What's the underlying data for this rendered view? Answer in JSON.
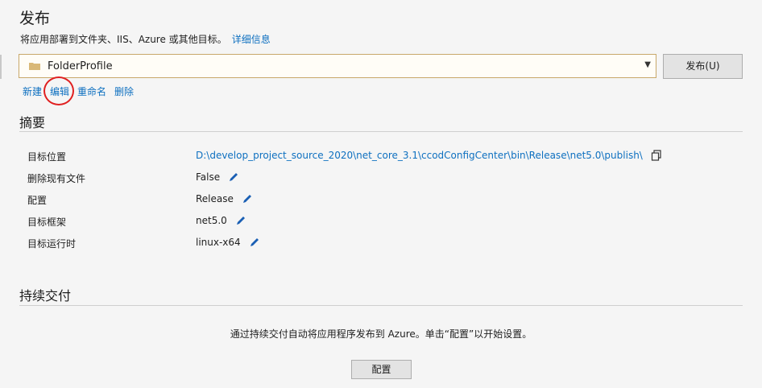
{
  "header": {
    "title": "发布",
    "subtitle": "将应用部署到文件夹、IIS、Azure 或其他目标。",
    "details_link": "详细信息"
  },
  "profile": {
    "name": "FolderProfile",
    "publish_button": "发布(U)"
  },
  "actions": {
    "new": "新建",
    "edit": "编辑",
    "rename": "重命名",
    "delete": "删除"
  },
  "summary": {
    "heading": "摘要",
    "rows": [
      {
        "label": "目标位置",
        "value": "D:\\develop_project_source_2020\\net_core_3.1\\ccodConfigCenter\\bin\\Release\\net5.0\\publish\\"
      },
      {
        "label": "删除现有文件",
        "value": "False"
      },
      {
        "label": "配置",
        "value": "Release"
      },
      {
        "label": "目标框架",
        "value": "net5.0"
      },
      {
        "label": "目标运行时",
        "value": "linux-x64"
      }
    ]
  },
  "continuous_delivery": {
    "heading": "持续交付",
    "text": "通过持续交付自动将应用程序发布到 Azure。单击“配置”以开始设置。",
    "config_button": "配置"
  },
  "colors": {
    "link": "#0e70c0",
    "highlight_circle": "#e02020",
    "background": "#f5f5f5"
  }
}
